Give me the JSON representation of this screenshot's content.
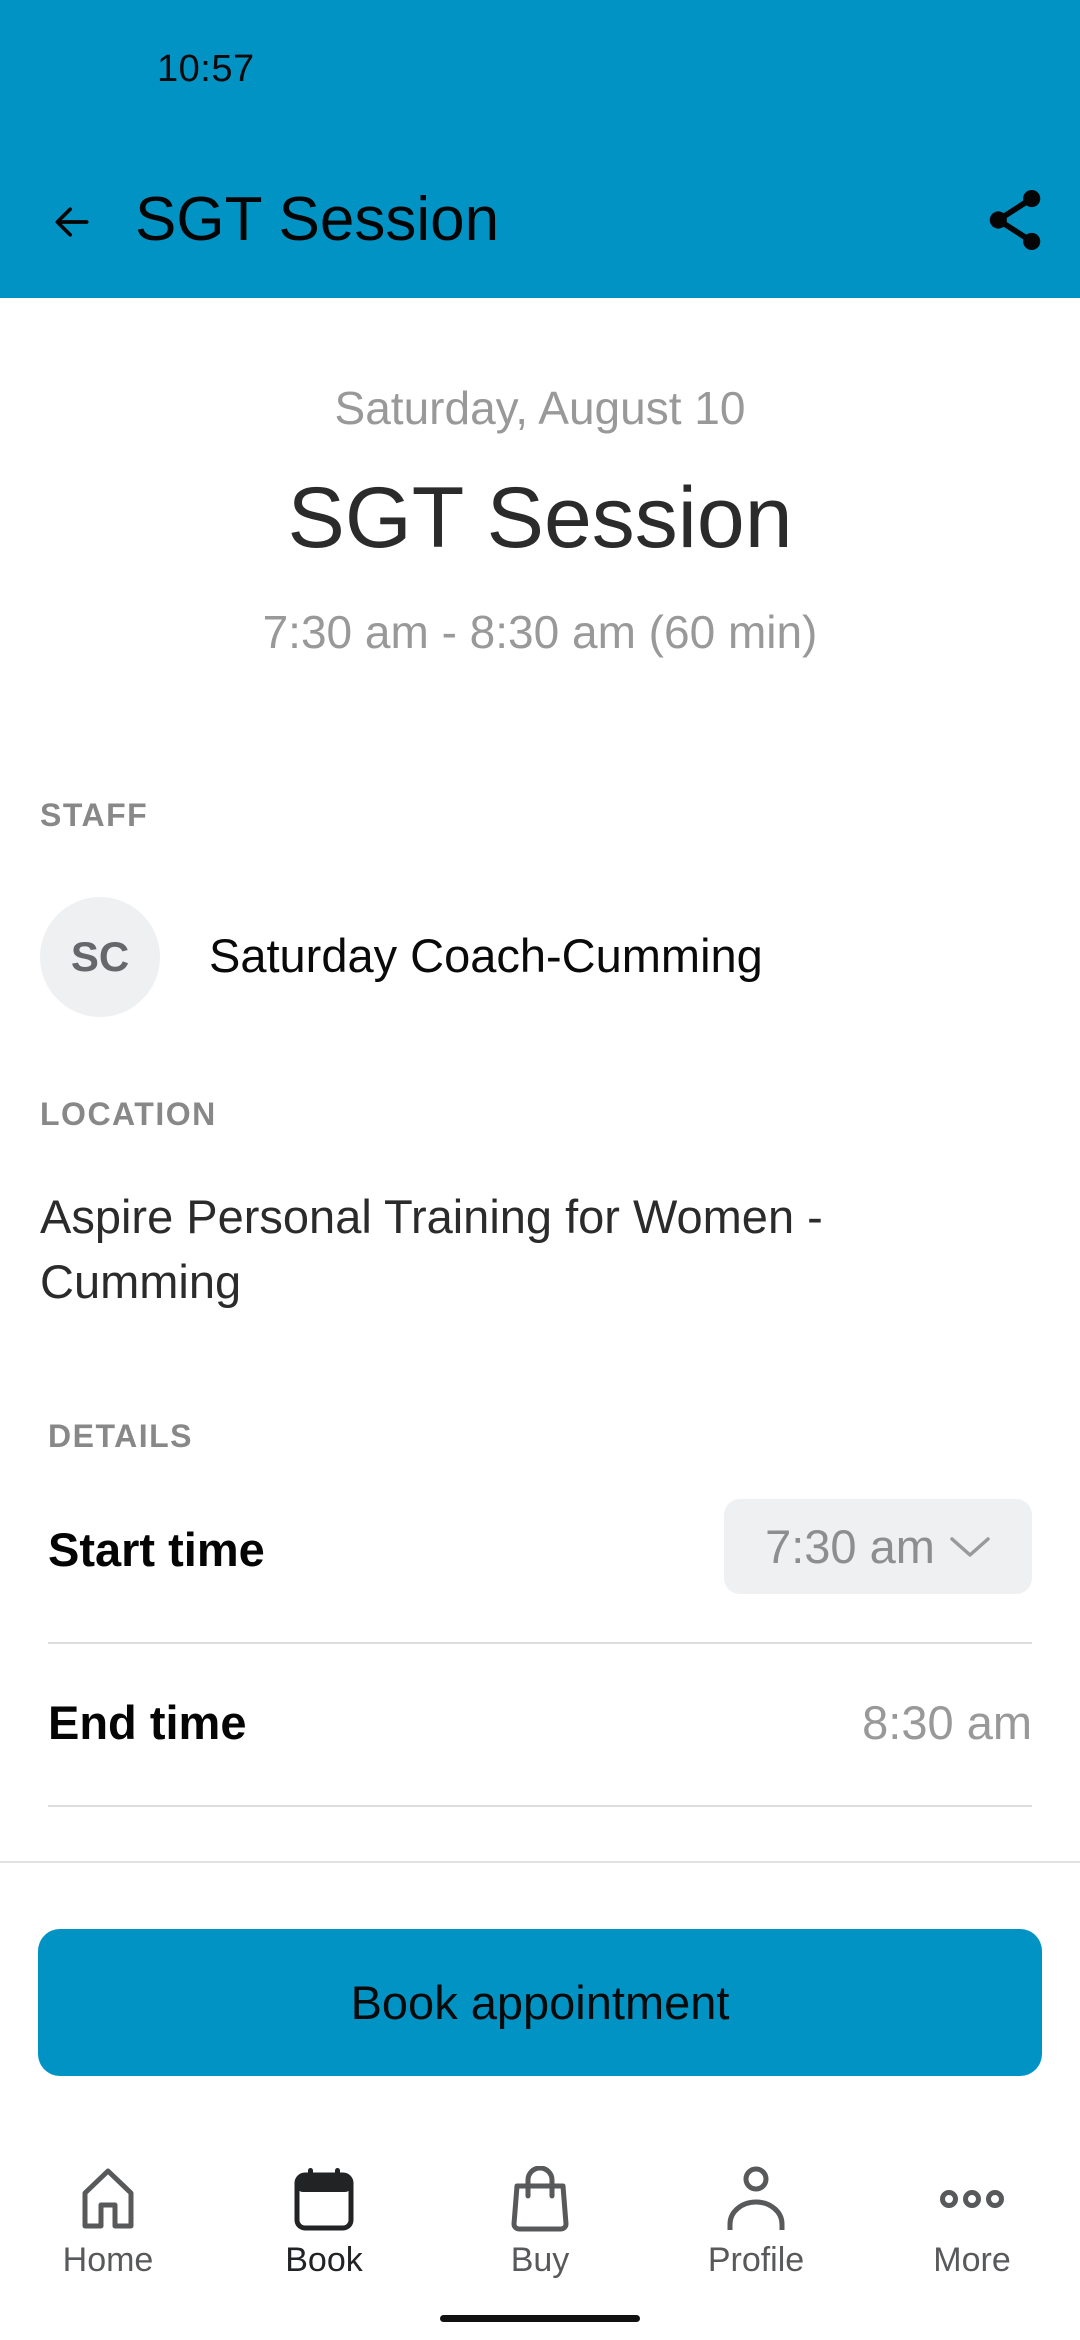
{
  "status_bar": {
    "time": "10:57"
  },
  "header": {
    "title": "SGT Session",
    "back_icon": "arrow-left-icon",
    "share_icon": "share-icon",
    "background_color": "#0093c4"
  },
  "session": {
    "date": "Saturday, August 10",
    "title": "SGT Session",
    "time_range": "7:30 am - 8:30 am (60 min)"
  },
  "staff": {
    "label": "STAFF",
    "initials": "SC",
    "name": "Saturday Coach-Cumming"
  },
  "location": {
    "label": "LOCATION",
    "name": "Aspire Personal Training for Women - Cumming"
  },
  "details": {
    "label": "DETAILS",
    "start_time_label": "Start time",
    "start_time_value": "7:30 am",
    "end_time_label": "End time",
    "end_time_value": "8:30 am"
  },
  "actions": {
    "book_label": "Book appointment",
    "accent_color": "#0093c4"
  },
  "nav": {
    "items": [
      {
        "label": "Home",
        "icon": "home-icon",
        "active": false
      },
      {
        "label": "Book",
        "icon": "calendar-icon",
        "active": true
      },
      {
        "label": "Buy",
        "icon": "shopping-bag-icon",
        "active": false
      },
      {
        "label": "Profile",
        "icon": "person-icon",
        "active": false
      },
      {
        "label": "More",
        "icon": "more-dots-icon",
        "active": false
      }
    ]
  }
}
